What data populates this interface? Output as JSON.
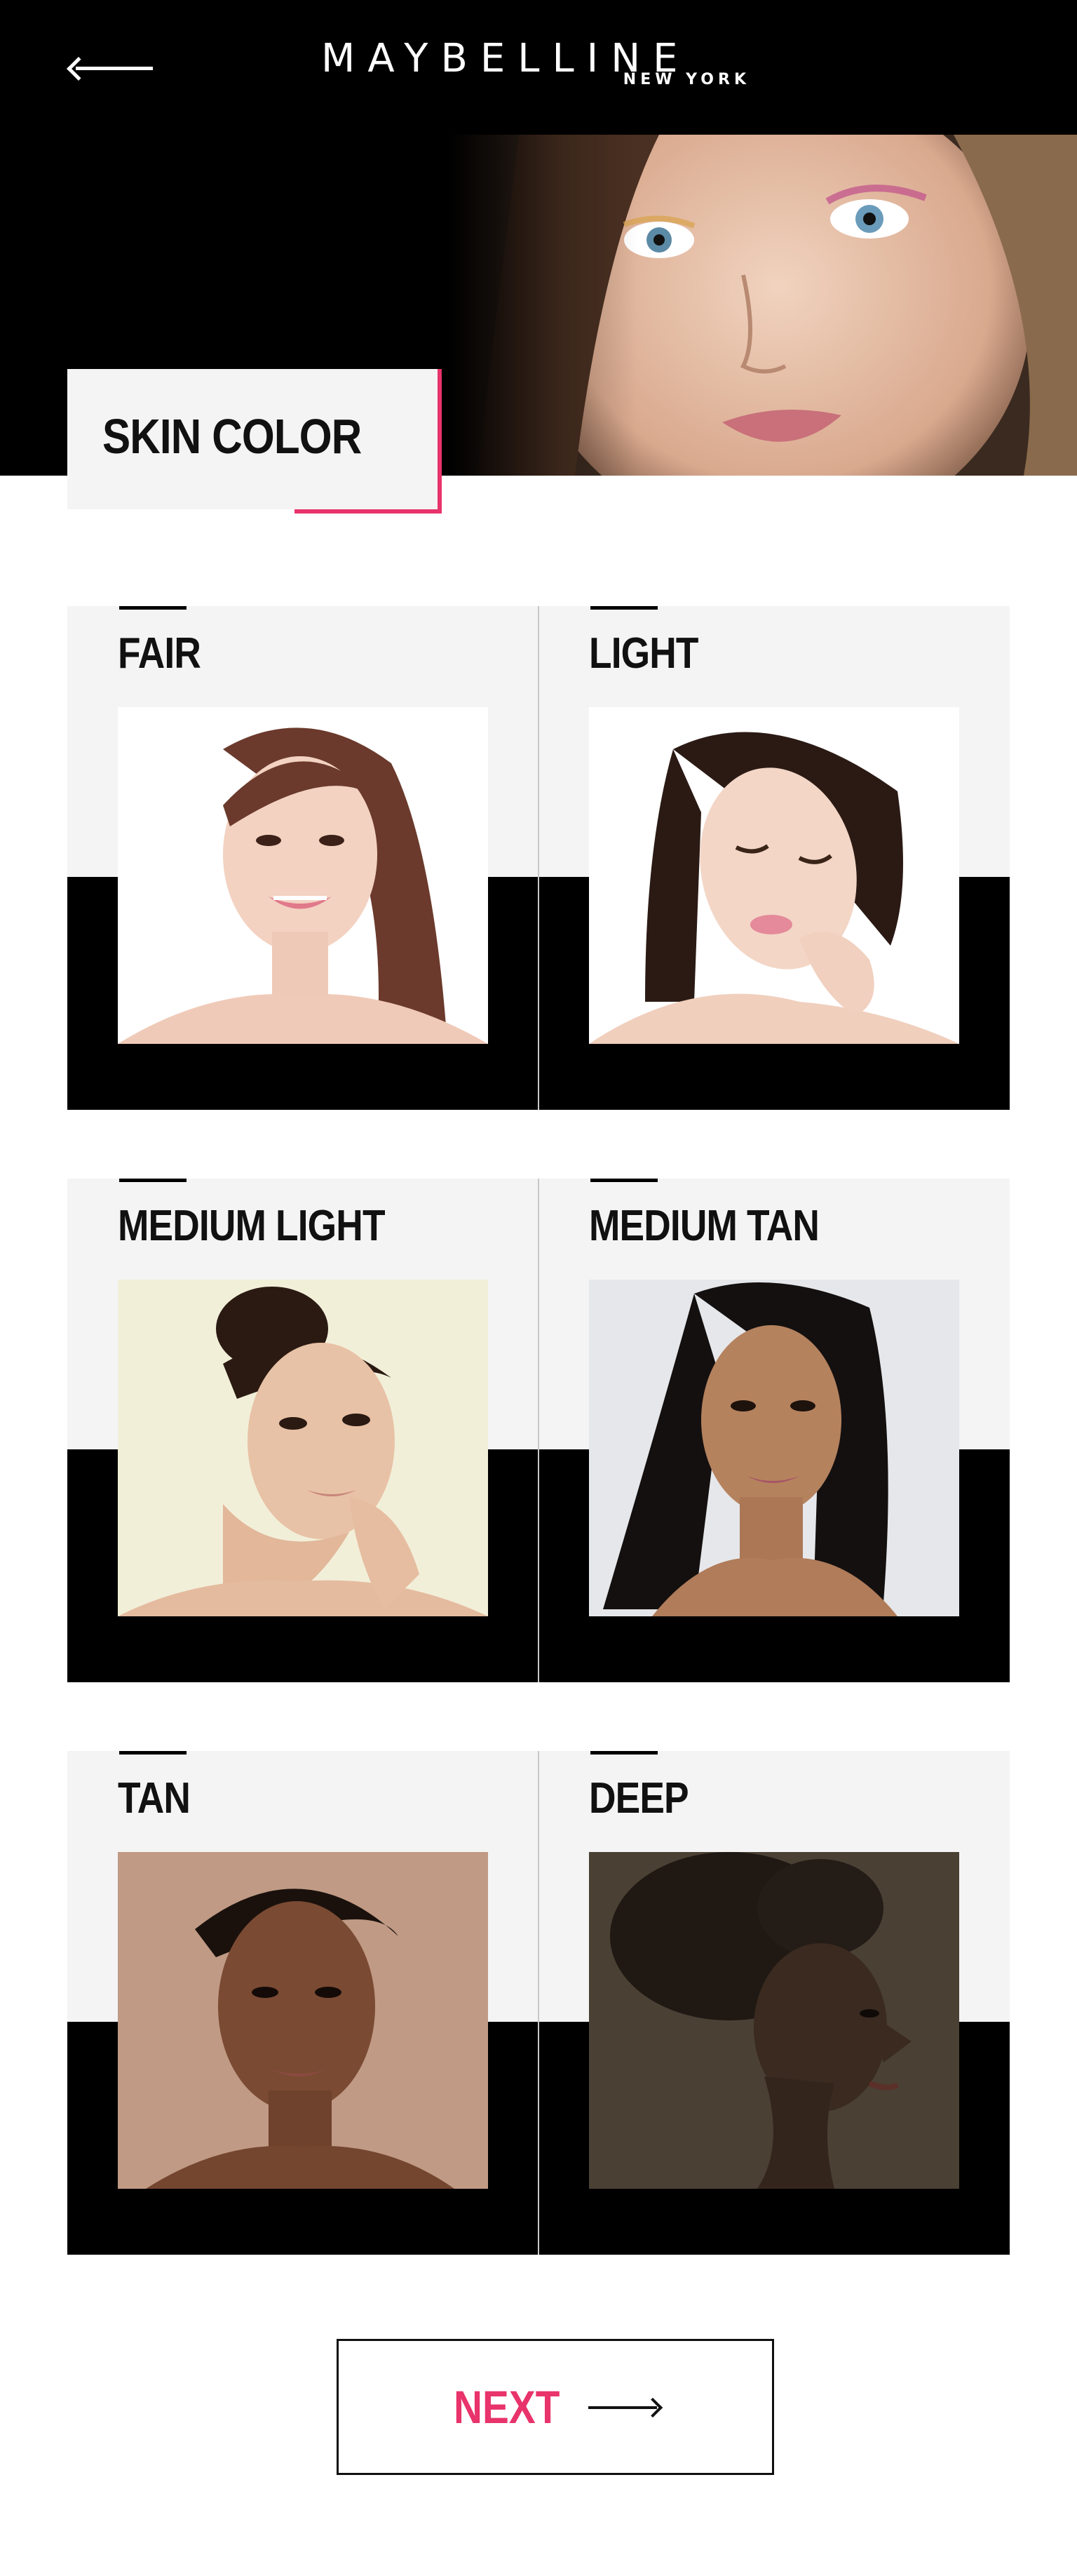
{
  "header": {
    "brand": "MAYBELLINE",
    "brand_sub": "NEW YORK",
    "back_icon": "arrow-left-icon"
  },
  "page": {
    "title": "SKIN COLOR"
  },
  "skin_options": [
    {
      "label": "FAIR"
    },
    {
      "label": "LIGHT"
    },
    {
      "label": "MEDIUM LIGHT"
    },
    {
      "label": "MEDIUM TAN"
    },
    {
      "label": "TAN"
    },
    {
      "label": "DEEP"
    }
  ],
  "next_button": {
    "label": "NEXT",
    "icon": "arrow-right-icon"
  },
  "colors": {
    "accent": "#e8336b",
    "header_bg": "#000000",
    "card_bg": "#f4f4f4"
  }
}
